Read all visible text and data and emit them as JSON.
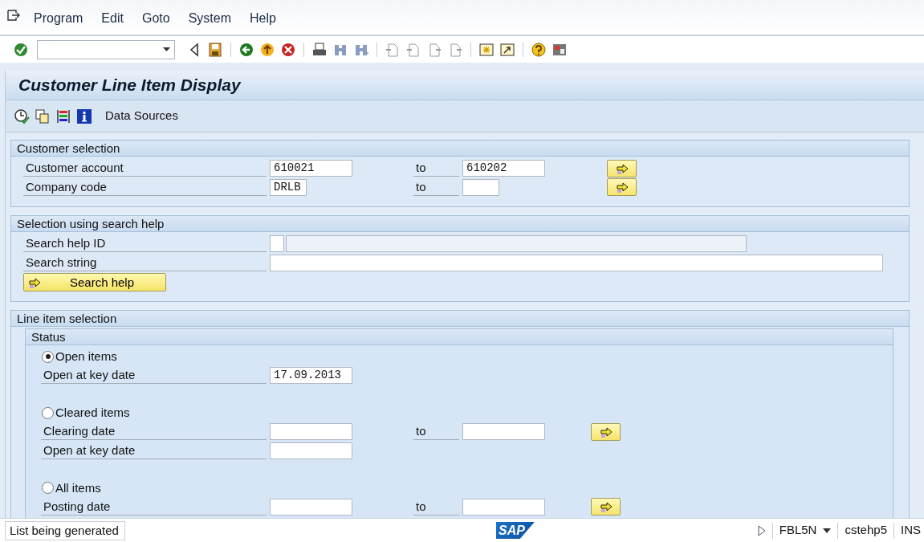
{
  "menu": [
    "Program",
    "Edit",
    "Goto",
    "System",
    "Help"
  ],
  "title": "Customer Line Item Display",
  "app_toolbar": {
    "button": "Data Sources"
  },
  "sections": [
    {
      "title": "Customer selection",
      "rows": [
        {
          "kind": "range",
          "label": "Customer account",
          "low": "610021",
          "to": "to",
          "high": "610202"
        },
        {
          "kind": "range_short",
          "label": "Company code",
          "low": "DRLB",
          "to": "to"
        }
      ]
    },
    {
      "title": "Selection using search help",
      "rows": [
        {
          "kind": "help_id",
          "label": "Search help ID"
        },
        {
          "kind": "long",
          "label": "Search string"
        },
        {
          "kind": "button",
          "label": "Search help"
        }
      ]
    },
    {
      "title": "Line item selection",
      "subsections": [
        {
          "title": "Status",
          "rows": [
            {
              "kind": "radio",
              "label": "Open items",
              "selected": true
            },
            {
              "kind": "field",
              "label": "Open at key date",
              "low": "17.09.2013"
            },
            {
              "kind": "gap"
            },
            {
              "kind": "radio",
              "label": "Cleared items",
              "selected": false
            },
            {
              "kind": "range",
              "label": "Clearing date",
              "to": "to"
            },
            {
              "kind": "field",
              "label": "Open at key date"
            },
            {
              "kind": "gap"
            },
            {
              "kind": "radio",
              "label": "All items",
              "selected": false
            },
            {
              "kind": "range",
              "label": "Posting date",
              "to": "to"
            }
          ]
        }
      ]
    }
  ],
  "status_bar": {
    "message": "List being generated",
    "logo": "SAP",
    "transaction": "FBL5N",
    "server": "cstehp5",
    "mode": "INS"
  }
}
